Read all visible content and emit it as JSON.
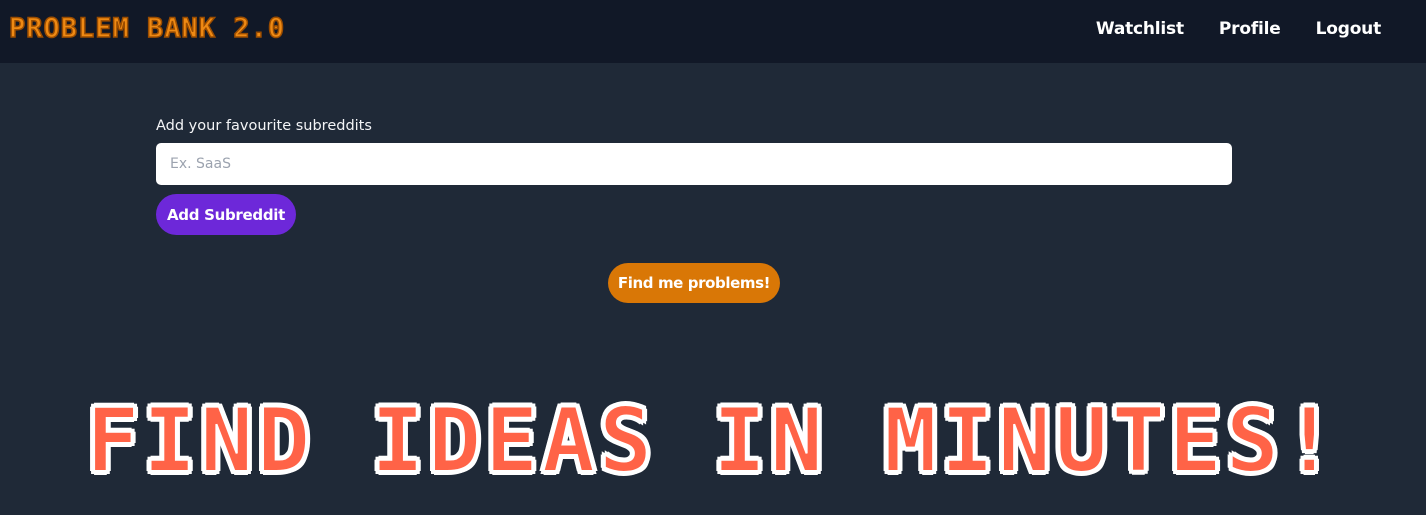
{
  "navbar": {
    "brand": "PROBLEM BANK 2.0",
    "links": [
      {
        "label": "Watchlist"
      },
      {
        "label": "Profile"
      },
      {
        "label": "Logout"
      }
    ]
  },
  "form": {
    "label": "Add your favourite subreddits",
    "input_placeholder": "Ex. SaaS",
    "input_value": "",
    "add_button": "Add Subreddit"
  },
  "find_button": "Find me problems!",
  "hero": {
    "text": "FIND IDEAS IN MINUTES!"
  },
  "colors": {
    "background": "#1f2937",
    "navbar": "#111827",
    "brand": "#ef8a14",
    "add_button": "#6d28d9",
    "find_button": "#d97706",
    "hero": "#ff6347"
  }
}
